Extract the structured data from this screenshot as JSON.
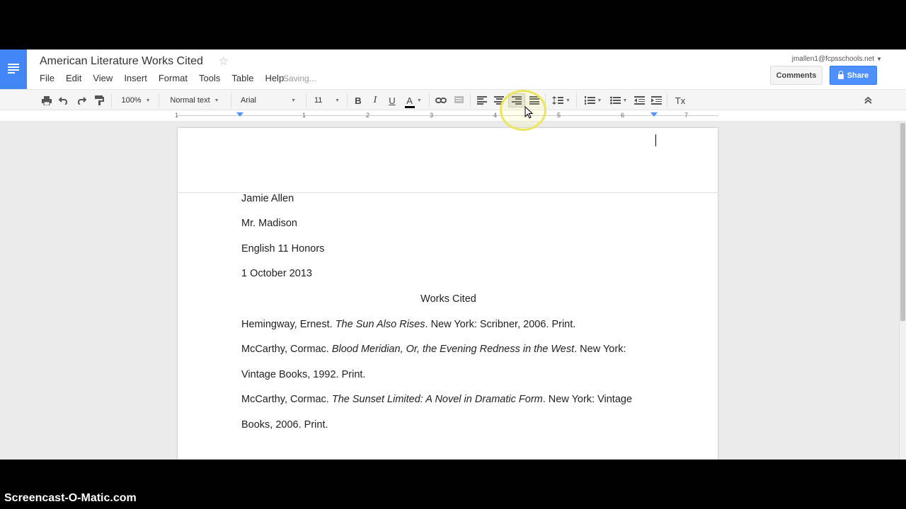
{
  "watermark": "Screencast-O-Matic.com",
  "header": {
    "title": "American Literature Works Cited",
    "account": "jmallen1@fcpsschools.net",
    "saving": "Saving...",
    "comments_label": "Comments",
    "share_label": "Share"
  },
  "menu": [
    "File",
    "Edit",
    "View",
    "Insert",
    "Format",
    "Tools",
    "Table",
    "Help"
  ],
  "toolbar": {
    "zoom": "100%",
    "style": "Normal text",
    "font": "Arial",
    "size": "11",
    "bold": "B",
    "italic": "I",
    "underline": "U",
    "text_color": "A",
    "clear_format": "Tx",
    "active_alignment": "right"
  },
  "ruler": {
    "numbers": [
      "1",
      "1",
      "2",
      "3",
      "4",
      "5",
      "6",
      "7"
    ]
  },
  "document": {
    "lines": {
      "l1": "Jamie Allen",
      "l2": "Mr. Madison",
      "l3": "English 11 Honors",
      "l4": "1 October 2013"
    },
    "heading": "Works Cited",
    "entries": {
      "e1_author": "Hemingway, Ernest. ",
      "e1_title": "The Sun Also Rises",
      "e1_rest": ". New York: Scribner, 2006. Print.",
      "e2_author": "McCarthy, Cormac. ",
      "e2_title": "Blood Meridian, Or, the Evening Redness in the West",
      "e2_rest": ". New York:",
      "e2_cont": "Vintage Books, 1992. Print.",
      "e3_author": "McCarthy, Cormac. ",
      "e3_title": "The Sunset Limited: A Novel in Dramatic Form",
      "e3_rest": ". New York: Vintage",
      "e3_cont": "Books, 2006. Print."
    }
  },
  "colors": {
    "brand": "#4285f4",
    "share": "#4d90fe",
    "highlight": "#ece55c"
  }
}
